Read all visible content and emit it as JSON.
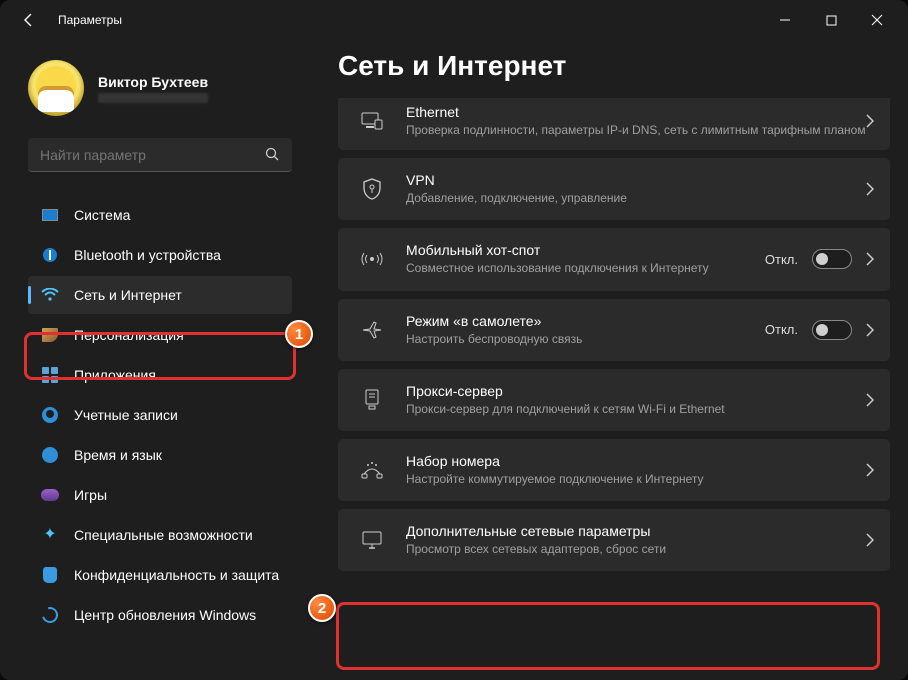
{
  "window": {
    "title": "Параметры"
  },
  "profile": {
    "name": "Виктор Бухтеев"
  },
  "search": {
    "placeholder": "Найти параметр"
  },
  "nav": [
    {
      "key": "system",
      "label": "Система"
    },
    {
      "key": "bluetooth",
      "label": "Bluetooth и устройства"
    },
    {
      "key": "network",
      "label": "Сеть и Интернет",
      "selected": true
    },
    {
      "key": "personal",
      "label": "Персонализация"
    },
    {
      "key": "apps",
      "label": "Приложения"
    },
    {
      "key": "accounts",
      "label": "Учетные записи"
    },
    {
      "key": "time",
      "label": "Время и язык"
    },
    {
      "key": "gaming",
      "label": "Игры"
    },
    {
      "key": "access",
      "label": "Специальные возможности"
    },
    {
      "key": "privacy",
      "label": "Конфиденциальность и защита"
    },
    {
      "key": "update",
      "label": "Центр обновления Windows"
    }
  ],
  "main": {
    "title": "Сеть и Интернет",
    "cards": [
      {
        "key": "ethernet",
        "title": "Ethernet",
        "sub": "Проверка подлинности, параметры IP-и DNS, сеть с лимитным тарифным планом"
      },
      {
        "key": "vpn",
        "title": "VPN",
        "sub": "Добавление, подключение, управление"
      },
      {
        "key": "hotspot",
        "title": "Мобильный хот-спот",
        "sub": "Совместное использование подключения к Интернету",
        "state": "Откл.",
        "toggle": true
      },
      {
        "key": "airplane",
        "title": "Режим «в самолете»",
        "sub": "Настроить беспроводную связь",
        "state": "Откл.",
        "toggle": true
      },
      {
        "key": "proxy",
        "title": "Прокси-сервер",
        "sub": "Прокси-сервер для подключений к сетям Wi-Fi и Ethernet"
      },
      {
        "key": "dialup",
        "title": "Набор номера",
        "sub": "Настройте коммутируемое подключение к Интернету"
      },
      {
        "key": "advanced",
        "title": "Дополнительные сетевые параметры",
        "sub": "Просмотр всех сетевых адаптеров, сброс сети"
      }
    ]
  },
  "annotations": {
    "badge1": "1",
    "badge2": "2"
  }
}
